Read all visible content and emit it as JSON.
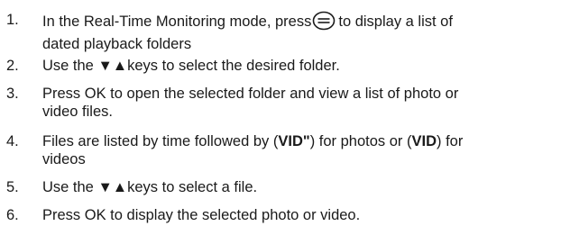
{
  "steps": [
    {
      "number": "1.",
      "line1_before_icon": "In the Real-Time Monitoring mode, press",
      "line1_after_icon": "to display a list of",
      "line2": "dated playback folders",
      "icon": "menu-button-icon"
    },
    {
      "number": "2.",
      "text": "Use the ▼▲keys to select the desired folder."
    },
    {
      "number": "3.",
      "line1": "Press OK to open  the selected folder and view a list of photo or",
      "line2": "video files."
    },
    {
      "number": "4.",
      "line1_a": "Files are listed by time followed by (",
      "line1_b": "VID\"",
      "line1_c": ") for photos or (",
      "line1_d": "VID",
      "line1_e": ") for",
      "line2": "videos"
    },
    {
      "number": "5.",
      "text": "Use the ▼▲keys to select a file."
    },
    {
      "number": "6.",
      "text": "Press OK to display the selected photo or video."
    }
  ]
}
